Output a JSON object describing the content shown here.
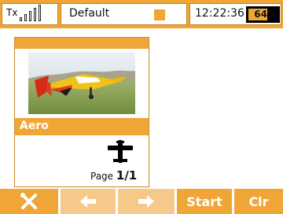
{
  "status": {
    "tx_label": "Tx",
    "model_name": "Default",
    "time": "12:22:36",
    "battery_percent": "64%",
    "battery_level": 0.64
  },
  "model": {
    "name": "Aero",
    "page_label": "Page",
    "page_value": "1/1"
  },
  "toolbar": {
    "start_label": "Start",
    "clear_label": "Clr"
  },
  "colors": {
    "accent": "#f0a637",
    "accent_dim": "#f6c88a",
    "border": "#c98a2a"
  },
  "icons": {
    "settings": "wrench-screwdriver-icon",
    "prev": "arrow-left-icon",
    "next": "arrow-right-icon",
    "model_type": "airplane-icon"
  }
}
